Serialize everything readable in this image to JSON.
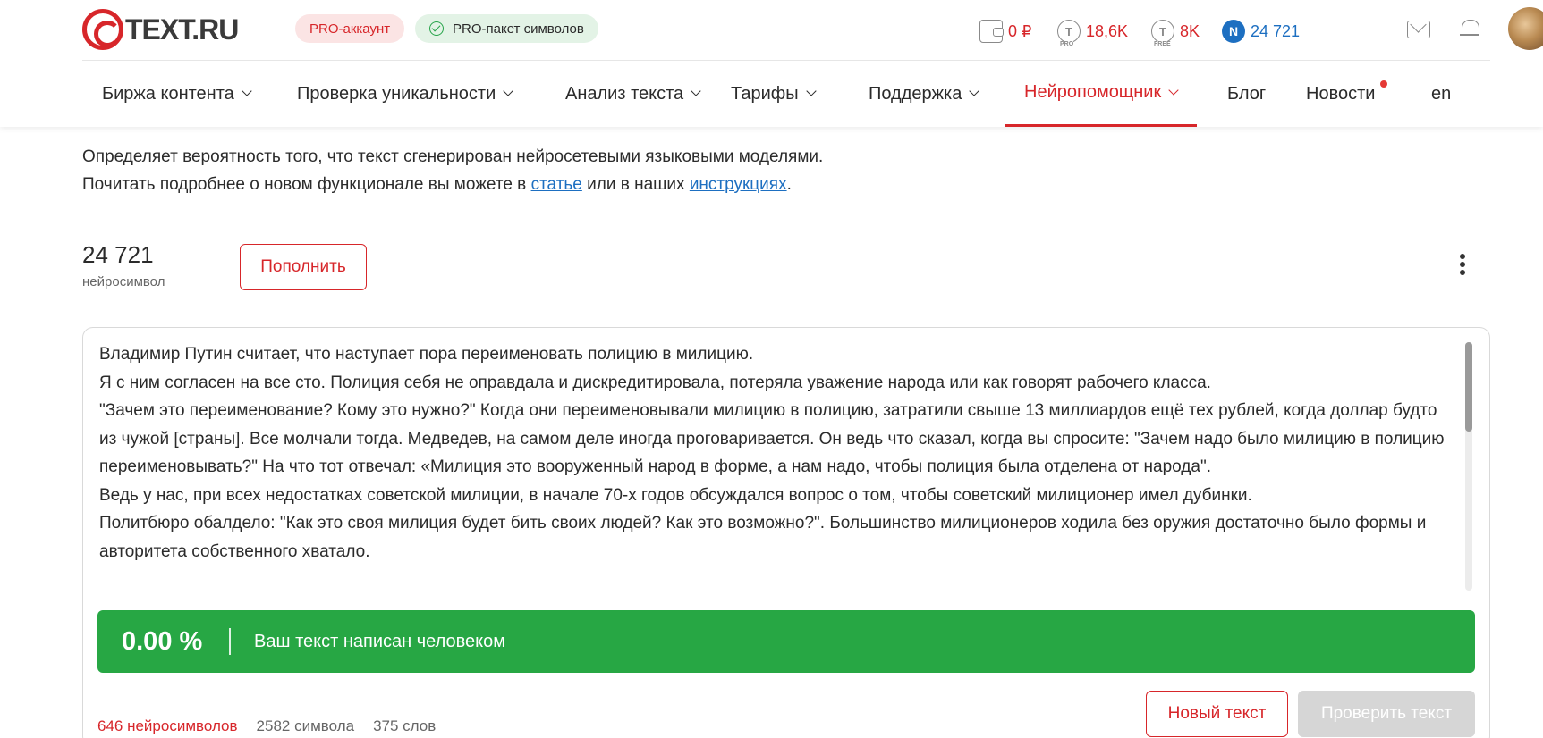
{
  "header": {
    "logo_text": "TEXT.RU",
    "pro_account": "PRO-аккаунт",
    "pro_pack": "PRO-пакет символов",
    "stats": {
      "wallet": "0 ₽",
      "pro_chars": "18,6K",
      "free_chars": "8K",
      "neuro_chars": "24 721"
    },
    "icon_labels": {
      "pro": "PRO",
      "free": "FREE",
      "t": "T",
      "n": "N"
    }
  },
  "nav": {
    "items": [
      {
        "label": "Биржа контента",
        "dropdown": true
      },
      {
        "label": "Проверка уникальности",
        "dropdown": true
      },
      {
        "label": "Анализ текста",
        "dropdown": true
      },
      {
        "label": "Тарифы",
        "dropdown": true
      },
      {
        "label": "Поддержка",
        "dropdown": true
      },
      {
        "label": "Нейропомощник",
        "dropdown": true,
        "active": true
      },
      {
        "label": "Блог"
      },
      {
        "label": "Новости"
      },
      {
        "label": "en"
      }
    ]
  },
  "desc": {
    "line1": "Определяет вероятность того, что текст сгенерирован нейросетевыми языковыми моделями.",
    "line2_prefix": "Почитать подробнее о новом функционале вы можете в ",
    "link1": "статье",
    "line2_mid": " или в наших ",
    "link2": "инструкциях",
    "line2_suffix": "."
  },
  "balance": {
    "value": "24 721",
    "label": "нейросимвол",
    "topup_label": "Пополнить"
  },
  "editor": {
    "paragraphs": [
      "Владимир Путин считает, что наступает пора переименовать полицию в милицию.",
      "Я с ним согласен на все сто. Полиция себя не оправдала и дискредитировала, потеряла уважение народа или как говорят рабочего класса.",
      "\"Зачем это переименование? Кому это нужно?\" Когда они переименовывали милицию в полицию, затратили свыше 13 миллиардов ещё тех рублей, когда доллар будто из чужой [страны]. Все молчали тогда. Медведев, на самом деле иногда проговаривается. Он ведь что сказал, когда вы спросите: \"Зачем надо было милицию в полицию переименовывать?\" На что тот отвечал: «Милиция это вооруженный народ в форме, а нам надо, чтобы полиция была отделена от народа\".",
      "Ведь у нас, при всех недостатках советской милиции, в начале 70-х годов обсуждался вопрос о том, чтобы советский милиционер имел дубинки.",
      "Политбюро обалдело: \"Как это своя милиция будет бить своих людей? Как это возможно?\". Большинство милиционеров ходила без оружия достаточно было формы и авторитета собственного хватало."
    ]
  },
  "result": {
    "percent": "0.00 %",
    "message": "Ваш текст написан человеком",
    "accent_color": "#27a744"
  },
  "counts": {
    "neuro": "646 нейросимволов",
    "chars": "2582 символа",
    "words": "375 слов"
  },
  "actions": {
    "new_text": "Новый текст",
    "check_text": "Проверить текст"
  }
}
